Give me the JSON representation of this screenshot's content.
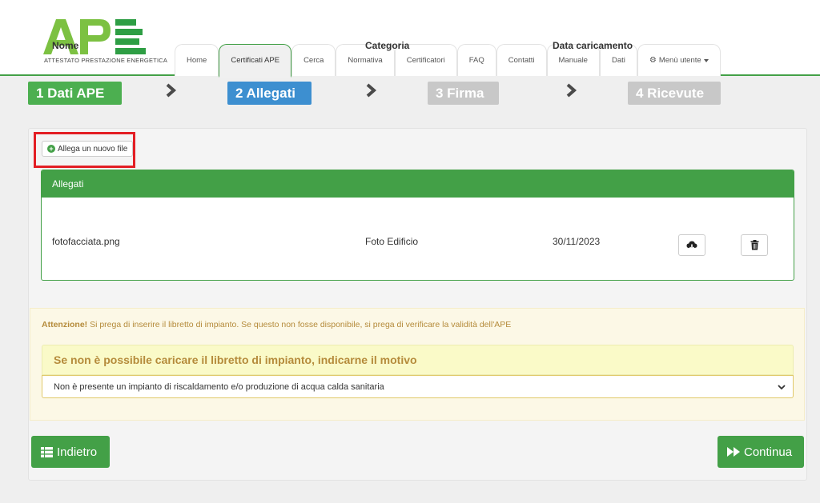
{
  "logo": {
    "letters": "APE",
    "subtitle": "ATTESTATO PRESTAZIONE ENERGETICA"
  },
  "nav": {
    "tabs": [
      {
        "label": "Home",
        "active": false
      },
      {
        "label": "Certificati APE",
        "active": true
      },
      {
        "label": "Cerca",
        "active": false
      },
      {
        "label": "Normativa",
        "active": false
      },
      {
        "label": "Certificatori",
        "active": false
      },
      {
        "label": "FAQ",
        "active": false
      },
      {
        "label": "Contatti",
        "active": false
      },
      {
        "label": "Manuale",
        "active": false
      },
      {
        "label": "Dati",
        "active": false
      },
      {
        "label": "Menù utente",
        "active": false
      }
    ]
  },
  "steps": [
    {
      "label": "1 Dati APE",
      "state": "done"
    },
    {
      "label": "2 Allegati",
      "state": "current"
    },
    {
      "label": "3 Firma",
      "state": "pending"
    },
    {
      "label": "4 Ricevute",
      "state": "pending"
    }
  ],
  "attach_button": {
    "label": "Allega un nuovo file"
  },
  "attachments": {
    "title": "Allegati",
    "columns": [
      "Nome",
      "Categoria",
      "Data caricamento"
    ],
    "rows": [
      {
        "nome": "fotofacciata.png",
        "categoria": "Foto Edificio",
        "data": "30/11/2023"
      }
    ]
  },
  "warning": {
    "strong": "Attenzione!",
    "text": " Si prega di inserire il libretto di impianto. Se questo non fosse disponibile, si prega di verificare la validità dell'APE",
    "reason_title": "Se non è possibile caricare il libretto di impianto, indicarne il motivo",
    "reason_selected": "Non è presente un impianto di riscaldamento e/o produzione di acqua calda sanitaria"
  },
  "buttons": {
    "back": "Indietro",
    "next": "Continua"
  },
  "colors": {
    "green": "#43a047",
    "blue": "#3d8fd0",
    "gray_step": "#c8c8c8",
    "highlight": "#e31e24"
  }
}
